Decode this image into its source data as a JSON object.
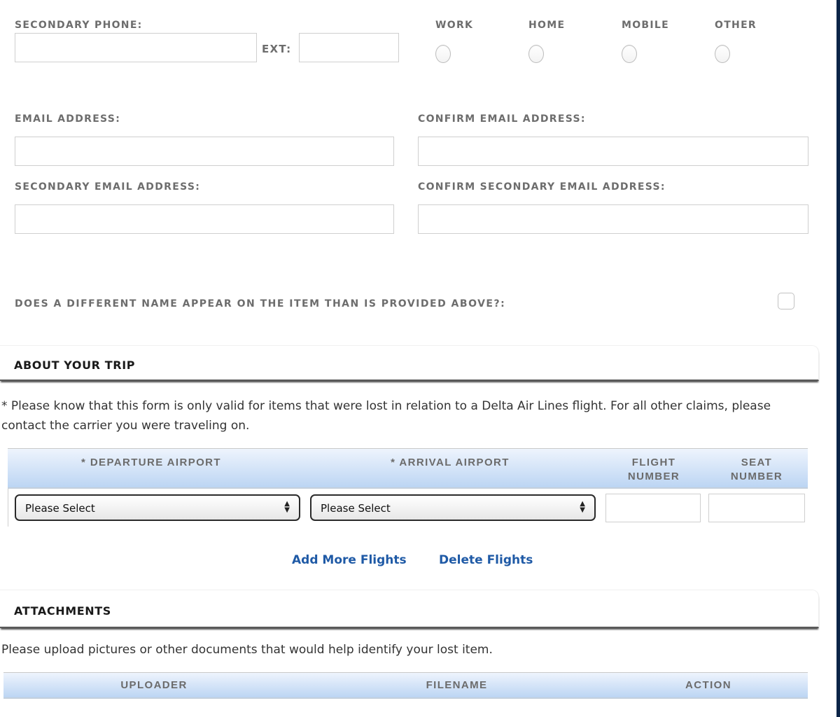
{
  "contact": {
    "secondary_phone_label": "SECONDARY PHONE:",
    "secondary_phone_value": "",
    "ext_label": "EXT:",
    "ext_value": "",
    "phone_types": [
      {
        "label": "WORK",
        "checked": false
      },
      {
        "label": "HOME",
        "checked": false
      },
      {
        "label": "MOBILE",
        "checked": false
      },
      {
        "label": "OTHER",
        "checked": false
      }
    ],
    "email_label": "EMAIL ADDRESS:",
    "email_value": "",
    "confirm_email_label": "CONFIRM EMAIL ADDRESS:",
    "confirm_email_value": "",
    "secondary_email_label": "SECONDARY EMAIL ADDRESS:",
    "secondary_email_value": "",
    "confirm_secondary_email_label": "CONFIRM SECONDARY EMAIL ADDRESS:",
    "confirm_secondary_email_value": "",
    "different_name_label": "DOES A DIFFERENT NAME APPEAR ON THE ITEM THAN IS PROVIDED ABOVE?:",
    "different_name_checked": false
  },
  "trip": {
    "section_title": "ABOUT YOUR TRIP",
    "notice": "* Please know that this form is only valid for items that were lost in relation to a Delta Air Lines flight. For all other claims, please contact the carrier you were traveling on.",
    "columns": {
      "departure": "* DEPARTURE AIRPORT",
      "arrival": "* ARRIVAL AIRPORT",
      "flight_line1": "FLIGHT",
      "flight_line2": "NUMBER",
      "seat_line1": "SEAT",
      "seat_line2": "NUMBER"
    },
    "rows": [
      {
        "departure": "Please Select",
        "arrival": "Please Select",
        "flight_number": "",
        "seat_number": ""
      }
    ],
    "add_link": "Add More Flights",
    "delete_link": "Delete Flights"
  },
  "attachments": {
    "section_title": "ATTACHMENTS",
    "instructions": "Please upload pictures or other documents that would help identify your lost item.",
    "columns": [
      "UPLOADER",
      "FILENAME",
      "ACTION"
    ]
  },
  "colors": {
    "link": "#1f5aa6",
    "label": "#6d6d6d",
    "grid_header_top": "#eef4fd",
    "grid_header_bottom": "#bcd5f3",
    "frame": "#0b2447"
  }
}
